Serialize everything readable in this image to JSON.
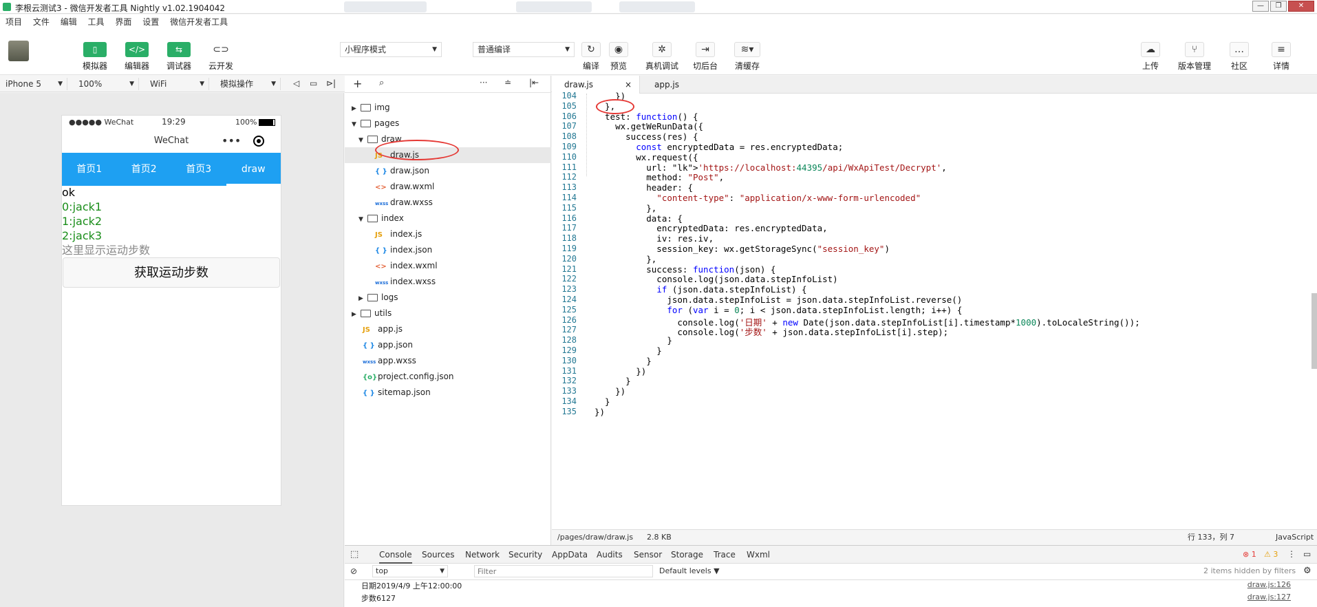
{
  "window": {
    "title": "李根云测试3 - 微信开发者工具 Nightly v1.02.1904042"
  },
  "menu": [
    "项目",
    "文件",
    "编辑",
    "工具",
    "界面",
    "设置",
    "微信开发者工具"
  ],
  "toolbar": {
    "simulator": "模拟器",
    "editor": "编辑器",
    "debugger": "调试器",
    "cloud": "云开发",
    "mode": "小程序模式",
    "compile_mode": "普通编译",
    "compile": "编译",
    "preview": "预览",
    "remote_debug": "真机调试",
    "background": "切后台",
    "clear_cache": "清缓存",
    "upload": "上传",
    "version": "版本管理",
    "community": "社区",
    "details": "详情"
  },
  "device": {
    "model": "iPhone 5",
    "zoom": "100%",
    "network": "WiFi",
    "operation": "模拟操作"
  },
  "phone": {
    "carrier": "●●●●● WeChat",
    "time": "19:29",
    "battery": "100%",
    "nav_title": "WeChat",
    "nav_dots": "•••",
    "tabs": [
      "首页1",
      "首页2",
      "首页3",
      "draw"
    ],
    "ok": "ok",
    "lines": [
      "0:jack1",
      "1:jack2",
      "2:jack3"
    ],
    "steps_placeholder": "这里显示运动步数",
    "button": "获取运动步数"
  },
  "tree": [
    {
      "name": "img",
      "kind": "folder",
      "open": false
    },
    {
      "name": "pages",
      "kind": "folder",
      "open": true
    },
    {
      "name": "draw",
      "kind": "folder",
      "open": true
    },
    {
      "name": "draw.js",
      "kind": "js",
      "type_label": "JS"
    },
    {
      "name": "draw.json",
      "kind": "json",
      "type_label": "{ }"
    },
    {
      "name": "draw.wxml",
      "kind": "wxml",
      "type_label": "<>"
    },
    {
      "name": "draw.wxss",
      "kind": "wxss",
      "type_label": "wxss"
    },
    {
      "name": "index",
      "kind": "folder",
      "open": true
    },
    {
      "name": "index.js",
      "kind": "js",
      "type_label": "JS"
    },
    {
      "name": "index.json",
      "kind": "json",
      "type_label": "{ }"
    },
    {
      "name": "index.wxml",
      "kind": "wxml",
      "type_label": "<>"
    },
    {
      "name": "index.wxss",
      "kind": "wxss",
      "type_label": "wxss"
    },
    {
      "name": "logs",
      "kind": "folder",
      "open": false
    },
    {
      "name": "utils",
      "kind": "folder",
      "open": false
    },
    {
      "name": "app.js",
      "kind": "js",
      "type_label": "JS"
    },
    {
      "name": "app.json",
      "kind": "json",
      "type_label": "{ }"
    },
    {
      "name": "app.wxss",
      "kind": "wxss",
      "type_label": "wxss"
    },
    {
      "name": "project.config.json",
      "kind": "cfg",
      "type_label": "{o}"
    },
    {
      "name": "sitemap.json",
      "kind": "json",
      "type_label": "{ }"
    }
  ],
  "editor": {
    "tabs": [
      "draw.js",
      "app.js"
    ],
    "close": "×",
    "lines": [
      {
        "n": "104",
        "t": "    })"
      },
      {
        "n": "105",
        "t": "  },"
      },
      {
        "n": "106",
        "t": "  test: function() {"
      },
      {
        "n": "107",
        "t": "    wx.getWeRunData({"
      },
      {
        "n": "108",
        "t": "      success(res) {"
      },
      {
        "n": "109",
        "t": "        const encryptedData = res.encryptedData;"
      },
      {
        "n": "110",
        "t": "        wx.request({"
      },
      {
        "n": "111",
        "t": "          url: 'https://localhost:44395/api/WxApiTest/Decrypt',"
      },
      {
        "n": "112",
        "t": "          method: \"Post\","
      },
      {
        "n": "113",
        "t": "          header: {"
      },
      {
        "n": "114",
        "t": "            \"content-type\": \"application/x-www-form-urlencoded\""
      },
      {
        "n": "115",
        "t": "          },"
      },
      {
        "n": "116",
        "t": "          data: {"
      },
      {
        "n": "117",
        "t": "            encryptedData: res.encryptedData,"
      },
      {
        "n": "118",
        "t": "            iv: res.iv,"
      },
      {
        "n": "119",
        "t": "            session_key: wx.getStorageSync(\"session_key\")"
      },
      {
        "n": "120",
        "t": "          },"
      },
      {
        "n": "121",
        "t": "          success: function(json) {"
      },
      {
        "n": "122",
        "t": "            console.log(json.data.stepInfoList)"
      },
      {
        "n": "123",
        "t": "            if (json.data.stepInfoList) {"
      },
      {
        "n": "124",
        "t": "              json.data.stepInfoList = json.data.stepInfoList.reverse()"
      },
      {
        "n": "125",
        "t": "              for (var i = 0; i < json.data.stepInfoList.length; i++) {"
      },
      {
        "n": "126",
        "t": "                console.log('日期' + new Date(json.data.stepInfoList[i].timestamp*1000).toLocaleString());"
      },
      {
        "n": "127",
        "t": "                console.log('步数' + json.data.stepInfoList[i].step);"
      },
      {
        "n": "128",
        "t": "              }"
      },
      {
        "n": "129",
        "t": "            }"
      },
      {
        "n": "130",
        "t": "          }"
      },
      {
        "n": "131",
        "t": "        })"
      },
      {
        "n": "132",
        "t": "      }"
      },
      {
        "n": "133",
        "t": "    })"
      },
      {
        "n": "134",
        "t": "  }"
      },
      {
        "n": "135",
        "t": "})"
      }
    ]
  },
  "status": {
    "path": "/pages/draw/draw.js",
    "size": "2.8 KB",
    "position": "行 133，列 7",
    "lang": "JavaScript"
  },
  "devtools": {
    "tabs": [
      "Console",
      "Sources",
      "Network",
      "Security",
      "AppData",
      "Audits",
      "Sensor",
      "Storage",
      "Trace",
      "Wxml"
    ],
    "errors": "1",
    "warnings": "3",
    "context": "top",
    "filter_placeholder": "Filter",
    "levels": "Default levels ▼",
    "hidden": "2 items hidden by filters",
    "logs": [
      {
        "text": "日期2019/4/9 上午12:00:00",
        "src": "draw.js:126"
      },
      {
        "text": "步数6127",
        "src": "draw.js:127"
      }
    ]
  },
  "colors": {
    "accent": "#2aae67",
    "tab_bar": "#1ea0f2",
    "annotation": "#e53935"
  }
}
